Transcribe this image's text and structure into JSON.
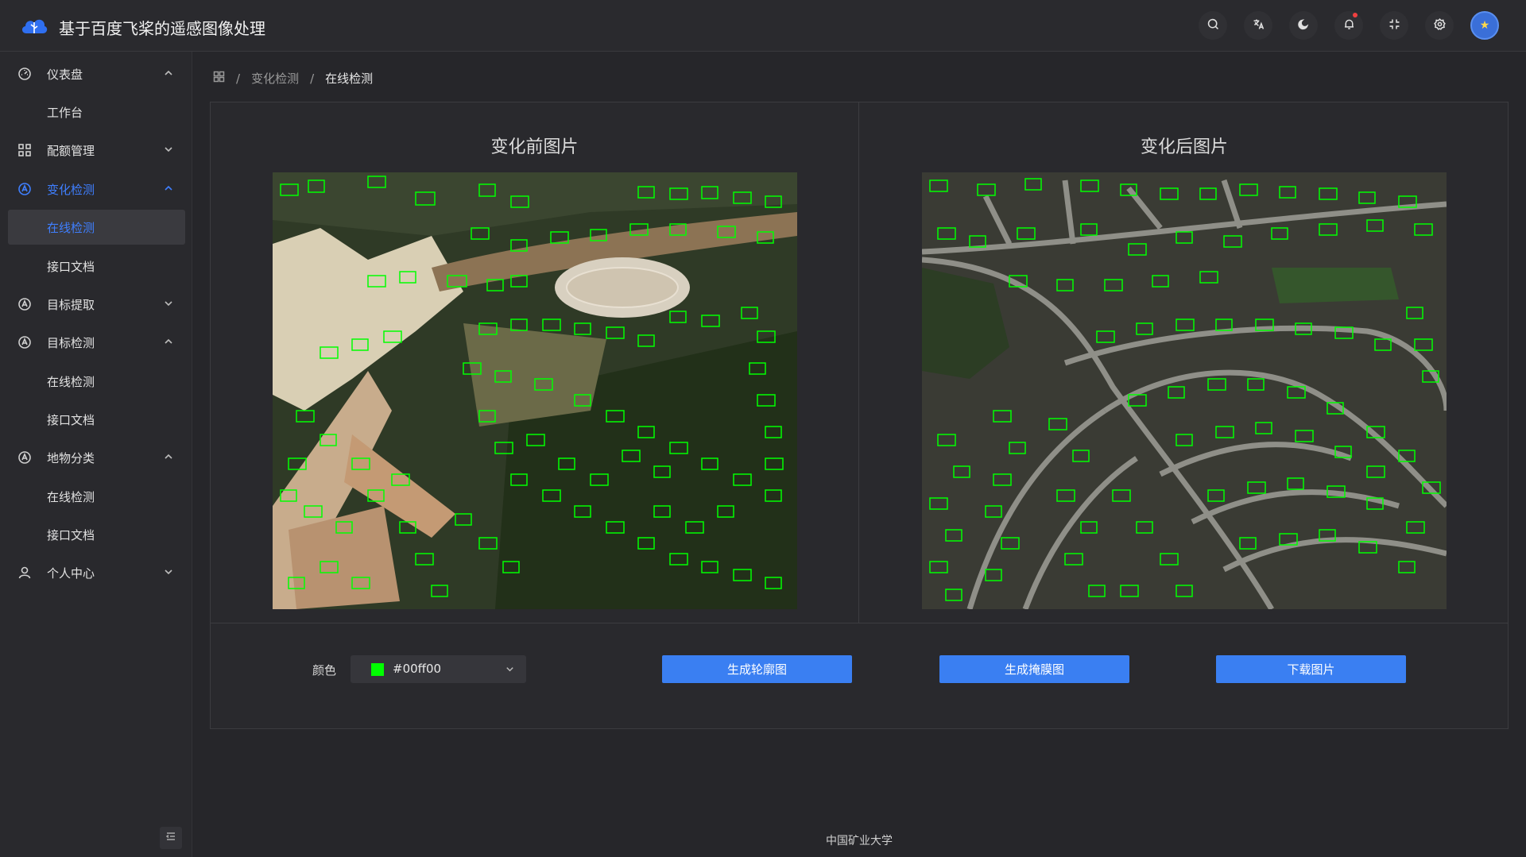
{
  "app": {
    "title": "基于百度飞桨的遥感图像处理"
  },
  "header": {
    "icons": [
      "search-icon",
      "translate-icon",
      "moon-icon",
      "bell-icon",
      "fullscreen-icon",
      "gear-icon",
      "avatar"
    ],
    "notification_dot_color": "#f04040"
  },
  "sidebar": {
    "items": [
      {
        "label": "仪表盘",
        "icon": "dashboard-icon",
        "expanded": true
      },
      {
        "label": "工作台",
        "sub": true
      },
      {
        "label": "配额管理",
        "icon": "grid-icon",
        "expanded": false
      },
      {
        "label": "变化检测",
        "icon": "detect-icon",
        "expanded": true,
        "active": true
      },
      {
        "label": "在线检测",
        "sub": true,
        "selected": true
      },
      {
        "label": "接口文档",
        "sub": true
      },
      {
        "label": "目标提取",
        "icon": "detect-icon",
        "expanded": false
      },
      {
        "label": "目标检测",
        "icon": "detect-icon",
        "expanded": true
      },
      {
        "label": "在线检测",
        "sub": true
      },
      {
        "label": "接口文档",
        "sub": true
      },
      {
        "label": "地物分类",
        "icon": "detect-icon",
        "expanded": true
      },
      {
        "label": "在线检测",
        "sub": true
      },
      {
        "label": "接口文档",
        "sub": true
      },
      {
        "label": "个人中心",
        "icon": "user-icon",
        "expanded": false
      }
    ]
  },
  "breadcrumb": {
    "items": [
      "变化检测",
      "在线检测"
    ]
  },
  "panels": {
    "before_title": "变化前图片",
    "after_title": "变化后图片"
  },
  "controls": {
    "color_label": "颜色",
    "color_value": "#00ff00",
    "swatch_color": "#00ff00",
    "btn_contour": "生成轮廓图",
    "btn_mask": "生成掩膜图",
    "btn_download": "下载图片"
  },
  "theme": {
    "accent": "#3a7ff2",
    "active_text": "#3f7fff",
    "outline_color": "#00ff00"
  },
  "footer": {
    "text": "中国矿业大学"
  }
}
